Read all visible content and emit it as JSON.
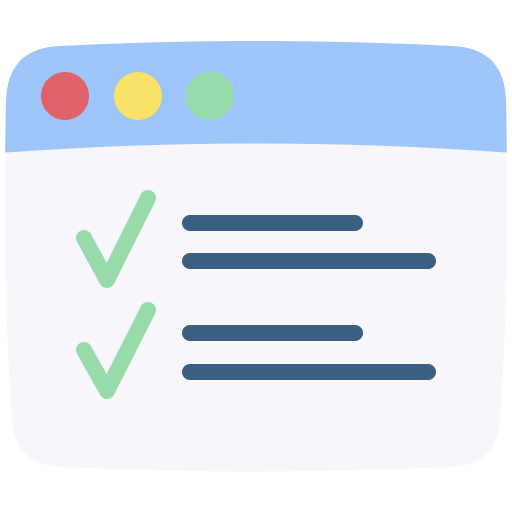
{
  "window": {
    "body_color": "#f8f6fa",
    "titlebar_color": "#9ec5f9",
    "controls": [
      {
        "name": "close-button",
        "color": "#e0626c"
      },
      {
        "name": "minimize-button",
        "color": "#f9e267"
      },
      {
        "name": "maximize-button",
        "color": "#98dbab"
      }
    ]
  },
  "checklist": {
    "check_color": "#98dbab",
    "line_color": "#3b5f80",
    "items": [
      {
        "checked": true
      },
      {
        "checked": true
      }
    ]
  }
}
